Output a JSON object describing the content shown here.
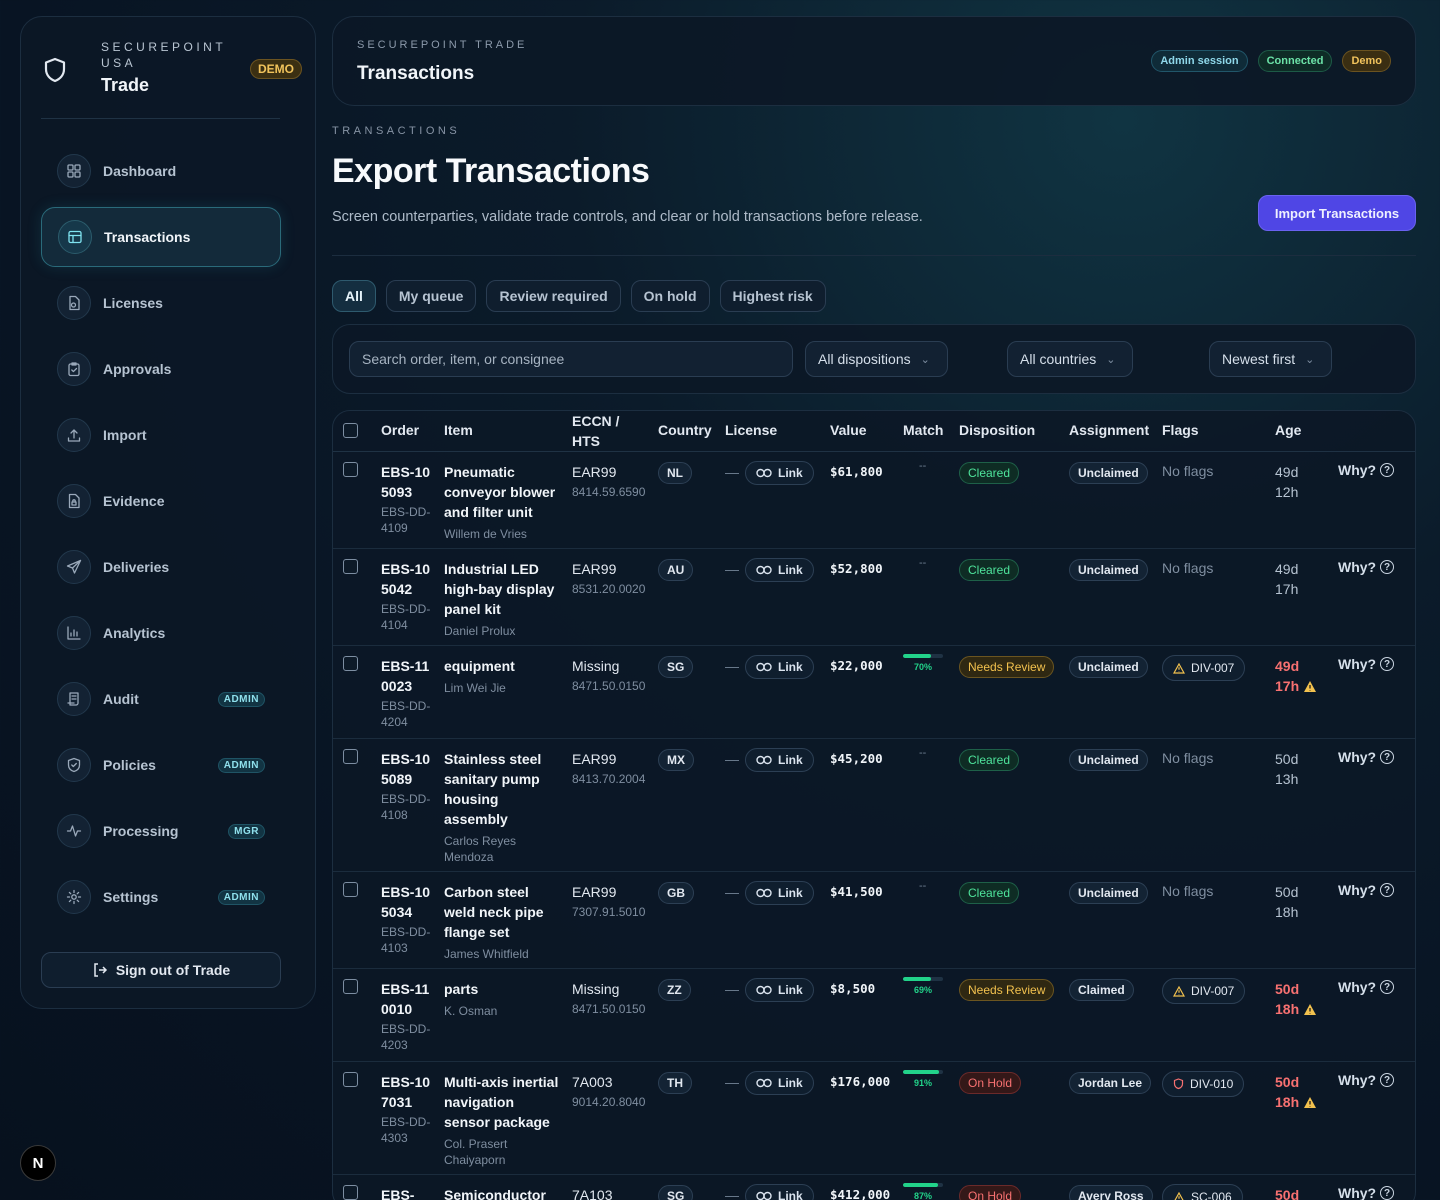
{
  "brand": {
    "org": "SECUREPOINT USA",
    "app": "Trade",
    "badge": "DEMO"
  },
  "nav": [
    {
      "label": "Dashboard",
      "icon": "grid-icon",
      "active": false,
      "badge": ""
    },
    {
      "label": "Transactions",
      "icon": "table-icon",
      "active": true,
      "badge": ""
    },
    {
      "label": "Licenses",
      "icon": "license-icon",
      "active": false,
      "badge": ""
    },
    {
      "label": "Approvals",
      "icon": "clipboard-check-icon",
      "active": false,
      "badge": ""
    },
    {
      "label": "Import",
      "icon": "upload-icon",
      "active": false,
      "badge": ""
    },
    {
      "label": "Evidence",
      "icon": "file-lock-icon",
      "active": false,
      "badge": ""
    },
    {
      "label": "Deliveries",
      "icon": "send-icon",
      "active": false,
      "badge": ""
    },
    {
      "label": "Analytics",
      "icon": "bar-chart-icon",
      "active": false,
      "badge": ""
    },
    {
      "label": "Audit",
      "icon": "scroll-icon",
      "active": false,
      "badge": "ADMIN"
    },
    {
      "label": "Policies",
      "icon": "shield-check-icon",
      "active": false,
      "badge": "ADMIN"
    },
    {
      "label": "Processing",
      "icon": "activity-icon",
      "active": false,
      "badge": "MGR"
    },
    {
      "label": "Settings",
      "icon": "gear-icon",
      "active": false,
      "badge": "ADMIN"
    }
  ],
  "signout_label": "Sign out of Trade",
  "header": {
    "eyebrow": "SECUREPOINT TRADE",
    "title": "Transactions",
    "pills": {
      "admin": "Admin session",
      "connected": "Connected",
      "demo": "Demo"
    }
  },
  "page": {
    "eyebrow": "TRANSACTIONS",
    "title": "Export Transactions",
    "subtitle": "Screen counterparties, validate trade controls, and clear or hold transactions before release.",
    "import_label": "Import Transactions"
  },
  "tabs": [
    "All",
    "My queue",
    "Review required",
    "On hold",
    "Highest risk"
  ],
  "filters": {
    "search_placeholder": "Search order, item, or consignee",
    "disposition": "All dispositions",
    "country": "All countries",
    "sort": "Newest first"
  },
  "table": {
    "columns": [
      "Order",
      "Item",
      "ECCN / HTS",
      "Country",
      "License",
      "Value",
      "Match",
      "Disposition",
      "Assignment",
      "Flags",
      "Age"
    ],
    "link_label": "Link",
    "license_dash": "—",
    "match_dash": "--",
    "why_label": "Why?",
    "rows": [
      {
        "order": "EBS-105093",
        "sub": "EBS-DD-4109",
        "item": "Pneumatic conveyor blower and filter unit",
        "consignee": "Willem de Vries",
        "eccn": "EAR99",
        "hts": "8414.59.6590",
        "country": "NL",
        "value": "$61,800",
        "match": null,
        "disposition": "Cleared",
        "disp_kind": "cleared",
        "assignment": "Unclaimed",
        "flag": "No flags",
        "flag_kind": "none",
        "age": "49d 12h",
        "late": false
      },
      {
        "order": "EBS-105042",
        "sub": "EBS-DD-4104",
        "item": "Industrial LED high-bay display panel kit",
        "consignee": "Daniel Prolux",
        "eccn": "EAR99",
        "hts": "8531.20.0020",
        "country": "AU",
        "value": "$52,800",
        "match": null,
        "disposition": "Cleared",
        "disp_kind": "cleared",
        "assignment": "Unclaimed",
        "flag": "No flags",
        "flag_kind": "none",
        "age": "49d 17h",
        "late": false
      },
      {
        "order": "EBS-110023",
        "sub": "EBS-DD-4204",
        "item": "equipment",
        "consignee": "Lim Wei Jie",
        "eccn": "Missing",
        "hts": "8471.50.0150",
        "country": "SG",
        "value": "$22,000",
        "match": 70,
        "disposition": "Needs Review",
        "disp_kind": "review",
        "assignment": "Unclaimed",
        "flag": "DIV-007",
        "flag_kind": "warn",
        "age": "49d 17h",
        "late": true
      },
      {
        "order": "EBS-105089",
        "sub": "EBS-DD-4108",
        "item": "Stainless steel sanitary pump housing assembly",
        "consignee": "Carlos Reyes Mendoza",
        "eccn": "EAR99",
        "hts": "8413.70.2004",
        "country": "MX",
        "value": "$45,200",
        "match": null,
        "disposition": "Cleared",
        "disp_kind": "cleared",
        "assignment": "Unclaimed",
        "flag": "No flags",
        "flag_kind": "none",
        "age": "50d 13h",
        "late": false
      },
      {
        "order": "EBS-105034",
        "sub": "EBS-DD-4103",
        "item": "Carbon steel weld neck pipe flange set",
        "consignee": "James Whitfield",
        "eccn": "EAR99",
        "hts": "7307.91.5010",
        "country": "GB",
        "value": "$41,500",
        "match": null,
        "disposition": "Cleared",
        "disp_kind": "cleared",
        "assignment": "Unclaimed",
        "flag": "No flags",
        "flag_kind": "none",
        "age": "50d 18h",
        "late": false
      },
      {
        "order": "EBS-110010",
        "sub": "EBS-DD-4203",
        "item": "parts",
        "consignee": "K. Osman",
        "eccn": "Missing",
        "hts": "8471.50.0150",
        "country": "ZZ",
        "value": "$8,500",
        "match": 69,
        "disposition": "Needs Review",
        "disp_kind": "review",
        "assignment": "Claimed",
        "flag": "DIV-007",
        "flag_kind": "warn",
        "age": "50d 18h",
        "late": true
      },
      {
        "order": "EBS-107031",
        "sub": "EBS-DD-4303",
        "item": "Multi-axis inertial navigation sensor package",
        "consignee": "Col. Prasert Chaiyaporn",
        "eccn": "7A003",
        "hts": "9014.20.8040",
        "country": "TH",
        "value": "$176,000",
        "match": 91,
        "disposition": "On Hold",
        "disp_kind": "hold",
        "assignment": "Jordan Lee",
        "flag": "DIV-010",
        "flag_kind": "shield",
        "age": "50d 18h",
        "late": true
      },
      {
        "order": "EBS-",
        "sub": "",
        "item": "Semiconductor",
        "consignee": "",
        "eccn": "7A103",
        "hts": "",
        "country": "SG",
        "value": "$412,000",
        "match": 87,
        "disposition": "On Hold",
        "disp_kind": "hold",
        "assignment": "Avery Ross",
        "flag": "SC-006",
        "flag_kind": "warn",
        "age": "50d",
        "late": true
      }
    ]
  },
  "corner_badge": "N",
  "colors": {
    "accent": "#4f46e5",
    "cleared": "#4ee39b",
    "review": "#f2c14e",
    "hold": "#f87171",
    "match": "#22d38a"
  }
}
